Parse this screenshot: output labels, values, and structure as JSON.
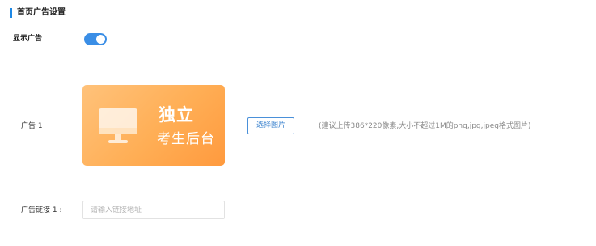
{
  "section": {
    "title": "首页广告设置"
  },
  "show_ad": {
    "label": "显示广告",
    "enabled": true
  },
  "ad1": {
    "label": "广告 1",
    "image_text_main": "独立",
    "image_text_sub": "考生后台",
    "choose_button": "选择图片",
    "hint": "(建议上传386*220像素,大小不超过1M的png,jpg,jpeg格式图片)",
    "link_label": "广告链接 1 :",
    "link_placeholder": "请输入链接地址",
    "link_value": ""
  },
  "colors": {
    "accent": "#3a8ee6",
    "image_gradient_start": "#ffc27a",
    "image_gradient_end": "#ff9a3e"
  },
  "icons": {
    "ad_image_icon": "monitor-icon"
  }
}
